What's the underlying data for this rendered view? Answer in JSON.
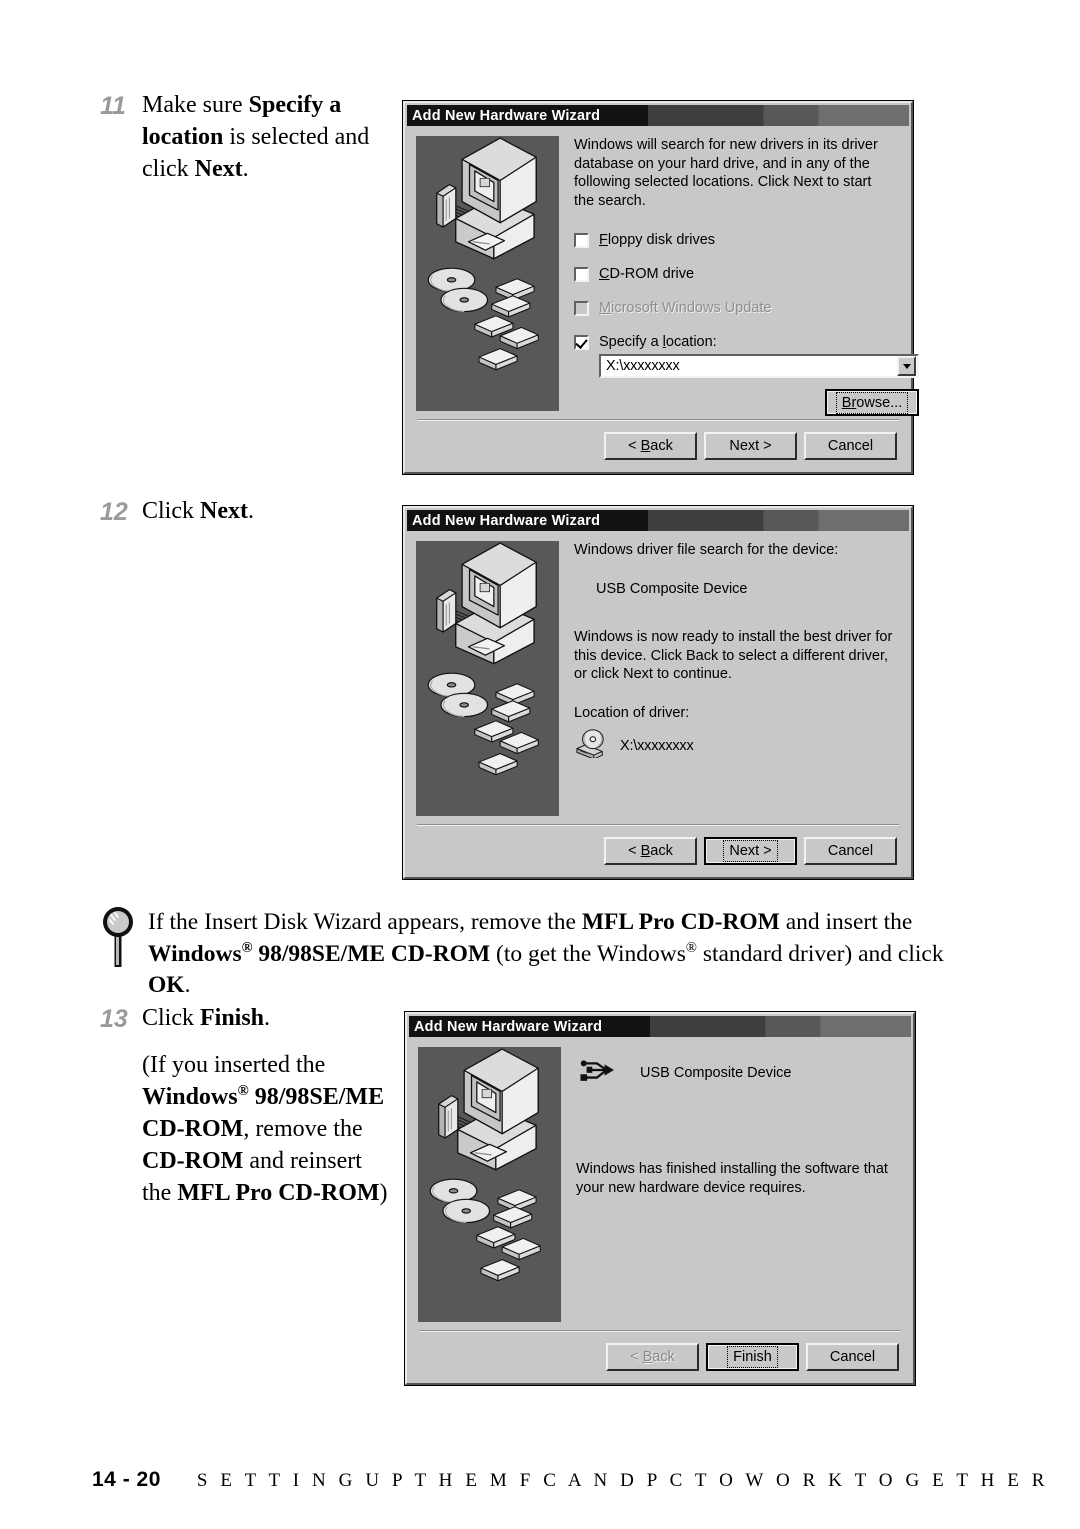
{
  "steps": {
    "s11": {
      "number": "11",
      "line1_a": "Make sure ",
      "line1_b": "Specify a location",
      "line1_c": " is selected and click ",
      "line1_d": "Next",
      "line1_e": "."
    },
    "s12": {
      "number": "12",
      "text_a": "Click ",
      "text_b": "Next",
      "text_c": "."
    },
    "s13": {
      "number": "13",
      "text_a": "Click ",
      "text_b": "Finish",
      "text_c": ".",
      "sub_a": "(If you inserted the ",
      "sub_b": "Windows",
      "sub_reg": "®",
      "sub_c": " 98/98SE/ME CD-ROM",
      "sub_d": ", remove the ",
      "sub_e": "CD-ROM",
      "sub_f": " and reinsert the ",
      "sub_g": "MFL Pro CD-ROM",
      "sub_h": ")"
    }
  },
  "note": {
    "icon": "magnifier-icon",
    "a": "If the Insert Disk Wizard appears, remove the ",
    "b": "MFL Pro CD-ROM",
    "c": " and insert the ",
    "d": "Windows",
    "reg1": "®",
    "e": " 98/98SE/ME CD-ROM",
    "f": " (to get the Windows",
    "reg2": "®",
    "g": " standard driver) and click ",
    "h": "OK",
    "i": "."
  },
  "footer": {
    "page": "14 - 20",
    "title": "S E T T I N G  U P  T H E  M F C  A N D  P C  T O  W O R K  T O G E T H E R"
  },
  "dialogs": {
    "d1": {
      "title": "Add New Hardware Wizard",
      "body_text": "Windows will search for new drivers in its driver database on your hard drive, and in any of the following selected locations. Click Next to start the search.",
      "checkboxes": [
        {
          "label_pre": "",
          "label_key": "F",
          "label_post": "loppy disk drives",
          "checked": false,
          "disabled": false
        },
        {
          "label_pre": "",
          "label_key": "C",
          "label_post": "D-ROM drive",
          "checked": false,
          "disabled": false
        },
        {
          "label_pre": "",
          "label_key": "M",
          "label_post": "icrosoft Windows Update",
          "checked": false,
          "disabled": true
        },
        {
          "label_pre": "Specify a ",
          "label_key": "l",
          "label_post": "ocation:",
          "checked": true,
          "disabled": false
        }
      ],
      "location_value": "X:\\xxxxxxxx",
      "browse_label_pre": "B",
      "browse_label_key": "r",
      "browse_label_post": "owse...",
      "buttons": [
        {
          "pre": "< ",
          "key": "B",
          "post": "ack",
          "state": "normal"
        },
        {
          "pre": "Next >",
          "key": "",
          "post": "",
          "state": "normal"
        },
        {
          "pre": "Cancel",
          "key": "",
          "post": "",
          "state": "normal"
        }
      ]
    },
    "d2": {
      "title": "Add New Hardware Wizard",
      "line1": "Windows driver file search for the device:",
      "device": "USB Composite Device",
      "line2": "Windows is now ready to install the best driver for this device. Click Back to select a different driver, or click Next to continue.",
      "line3": "Location of driver:",
      "driver_icon": "cdrom-drive-icon",
      "driver_path": "X:\\xxxxxxxx",
      "buttons": [
        {
          "pre": "< ",
          "key": "B",
          "post": "ack",
          "state": "normal"
        },
        {
          "pre": "Next >",
          "key": "",
          "post": "",
          "state": "default"
        },
        {
          "pre": "Cancel",
          "key": "",
          "post": "",
          "state": "normal"
        }
      ]
    },
    "d3": {
      "title": "Add New Hardware Wizard",
      "device_icon": "usb-icon",
      "device": "USB Composite Device",
      "body_text": "Windows has finished installing the software that your new hardware device requires.",
      "buttons": [
        {
          "pre": "< ",
          "key": "B",
          "post": "ack",
          "state": "disabled"
        },
        {
          "pre": "Finish",
          "key": "",
          "post": "",
          "state": "default"
        },
        {
          "pre": "Cancel",
          "key": "",
          "post": "",
          "state": "normal"
        }
      ]
    }
  },
  "colors": {
    "dialog_face": "#c8c8c8",
    "illustration_bg": "#585858",
    "titlebar_dark": "#121212",
    "step_number": "#9a9a9a"
  }
}
